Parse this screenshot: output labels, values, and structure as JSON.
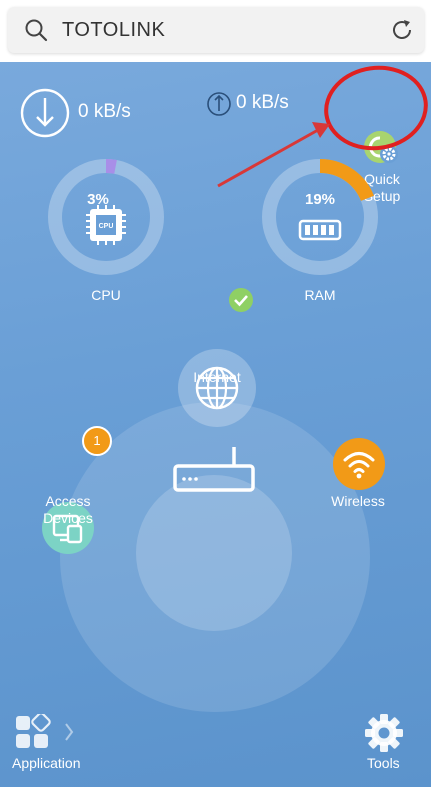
{
  "search": {
    "query": "TOTOLINK"
  },
  "speed": {
    "download": "0 kB/s",
    "upload": "0 kB/s"
  },
  "quick_setup": {
    "label_line1": "Quick",
    "label_line2": "Setup"
  },
  "cpu": {
    "value": "3%",
    "label": "CPU",
    "percent": 3
  },
  "ram": {
    "value": "19%",
    "label": "RAM",
    "percent": 19
  },
  "internet": {
    "label": "Internet"
  },
  "access_devices": {
    "label_line1": "Access",
    "label_line2": "Devices",
    "badge": "1"
  },
  "wireless": {
    "label": "Wireless"
  },
  "bottom": {
    "application": "Application",
    "tools": "Tools"
  },
  "colors": {
    "bg_top": "#79a9dc",
    "accent_orange": "#f29a17",
    "accent_teal": "#7cd3c5",
    "cpu_arc": "#a88ee8",
    "annotation_red": "#e02020"
  }
}
